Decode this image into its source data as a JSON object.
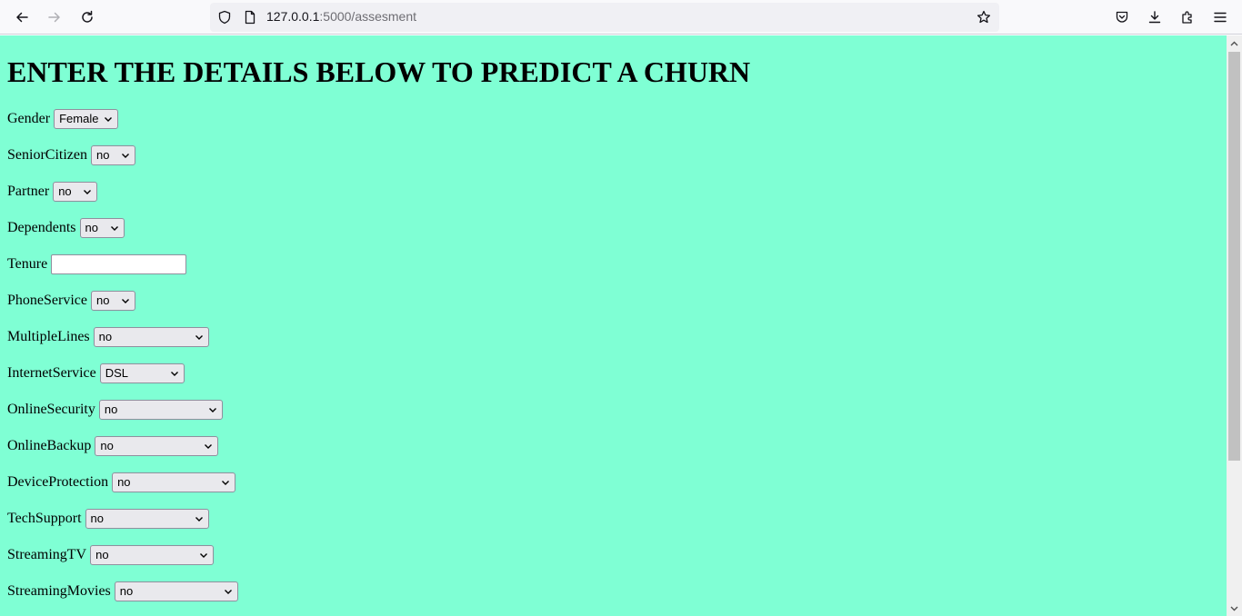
{
  "browser": {
    "url_host": "127.0.0.1",
    "url_path": ":5000/assesment"
  },
  "page": {
    "title": "ENTER THE DETAILS BELOW TO PREDICT A CHURN",
    "background": "#7fffd4",
    "fields": {
      "gender": {
        "label": "Gender",
        "value": "Female"
      },
      "senior_citizen": {
        "label": "SeniorCitizen",
        "value": "no"
      },
      "partner": {
        "label": "Partner",
        "value": "no"
      },
      "dependents": {
        "label": "Dependents",
        "value": "no"
      },
      "tenure": {
        "label": "Tenure",
        "value": ""
      },
      "phone_service": {
        "label": "PhoneService",
        "value": "no"
      },
      "multiple_lines": {
        "label": "MultipleLines",
        "value": "no"
      },
      "internet_service": {
        "label": "InternetService",
        "value": "DSL"
      },
      "online_security": {
        "label": "OnlineSecurity",
        "value": "no"
      },
      "online_backup": {
        "label": "OnlineBackup",
        "value": "no"
      },
      "device_protection": {
        "label": "DeviceProtection",
        "value": "no"
      },
      "tech_support": {
        "label": "TechSupport",
        "value": "no"
      },
      "streaming_tv": {
        "label": "StreamingTV",
        "value": "no"
      },
      "streaming_movies": {
        "label": "StreamingMovies",
        "value": "no"
      }
    }
  }
}
